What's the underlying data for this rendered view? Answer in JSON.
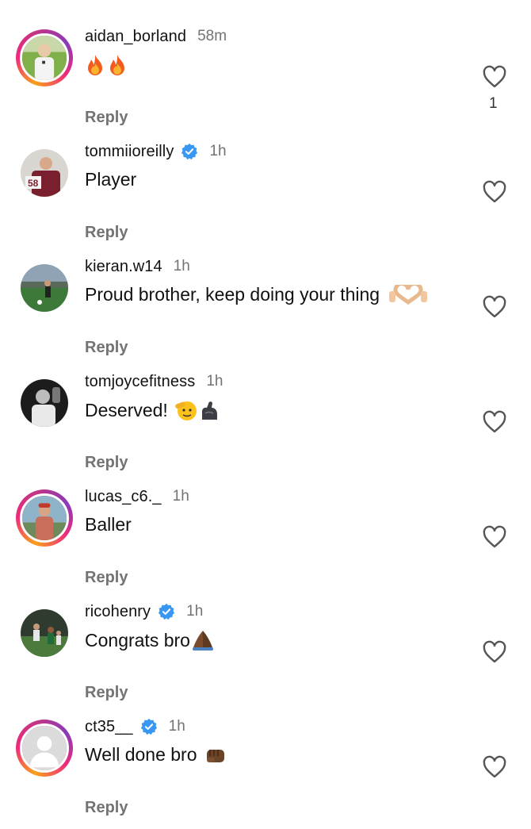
{
  "comments": [
    {
      "username": "aidan_borland",
      "verified": false,
      "time": "58m",
      "text": "",
      "emojis": [
        "fire",
        "fire"
      ],
      "reply_label": "Reply",
      "like_count": "1",
      "avatar_ring": "story"
    },
    {
      "username": "tommiioreilly",
      "verified": true,
      "time": "1h",
      "text": "Player",
      "emojis": [],
      "reply_label": "Reply",
      "like_count": "",
      "avatar_ring": "none"
    },
    {
      "username": "kieran.w14",
      "verified": false,
      "time": "1h",
      "text": "Proud brother, keep doing your thing",
      "emojis": [
        "heart-hands"
      ],
      "reply_label": "Reply",
      "like_count": "",
      "avatar_ring": "none"
    },
    {
      "username": "tomjoycefitness",
      "verified": false,
      "time": "1h",
      "text": "Deserved!",
      "emojis": [
        "saluting-face",
        "flexed-biceps"
      ],
      "reply_label": "Reply",
      "like_count": "",
      "avatar_ring": "none"
    },
    {
      "username": "lucas_c6._",
      "verified": false,
      "time": "1h",
      "text": "Baller",
      "emojis": [],
      "reply_label": "Reply",
      "like_count": "",
      "avatar_ring": "story"
    },
    {
      "username": "ricohenry",
      "verified": true,
      "time": "1h",
      "text": "Congrats bro",
      "emojis": [
        "folded-hands"
      ],
      "reply_label": "Reply",
      "like_count": "",
      "avatar_ring": "none"
    },
    {
      "username": "ct35__",
      "verified": true,
      "time": "1h",
      "text": "Well done bro",
      "emojis": [
        "oncoming-fist"
      ],
      "reply_label": "Reply",
      "like_count": "",
      "avatar_ring": "story"
    }
  ],
  "colors": {
    "verified": "#3897f0",
    "secondary_text": "#737373"
  },
  "icons": {
    "like": "heart-outline-icon",
    "verified": "verified-badge-icon"
  }
}
